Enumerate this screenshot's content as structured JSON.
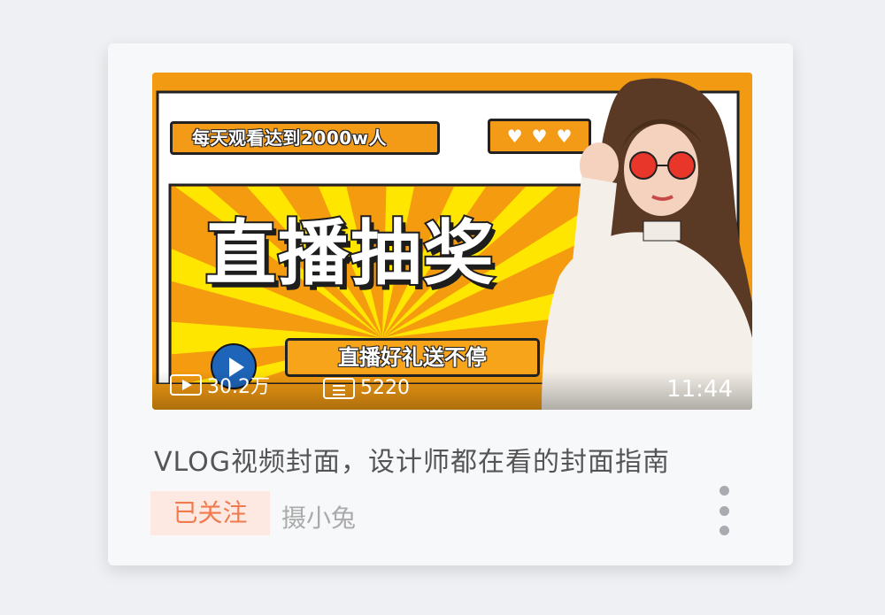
{
  "video": {
    "banner_top": "每天观看达到2000w人",
    "hearts": [
      "♥",
      "♥",
      "♥"
    ],
    "big_title": "直播抽奖",
    "sub_banner": "直播好礼送不停",
    "play_count": "30.2万",
    "danmu_count": "5220",
    "duration": "11:44"
  },
  "title": "VLOG视频封面，设计师都在看的封面指南",
  "follow_label": "已关注",
  "author": "摄小兔",
  "colors": {
    "accent_orange": "#f19a12",
    "sunburst_yellow": "#ffe600",
    "follow_text": "#ef7b4f",
    "follow_bg": "#fde9e2"
  },
  "icons": [
    "play-icon",
    "danmu-icon",
    "heart-icon",
    "more-icon"
  ]
}
